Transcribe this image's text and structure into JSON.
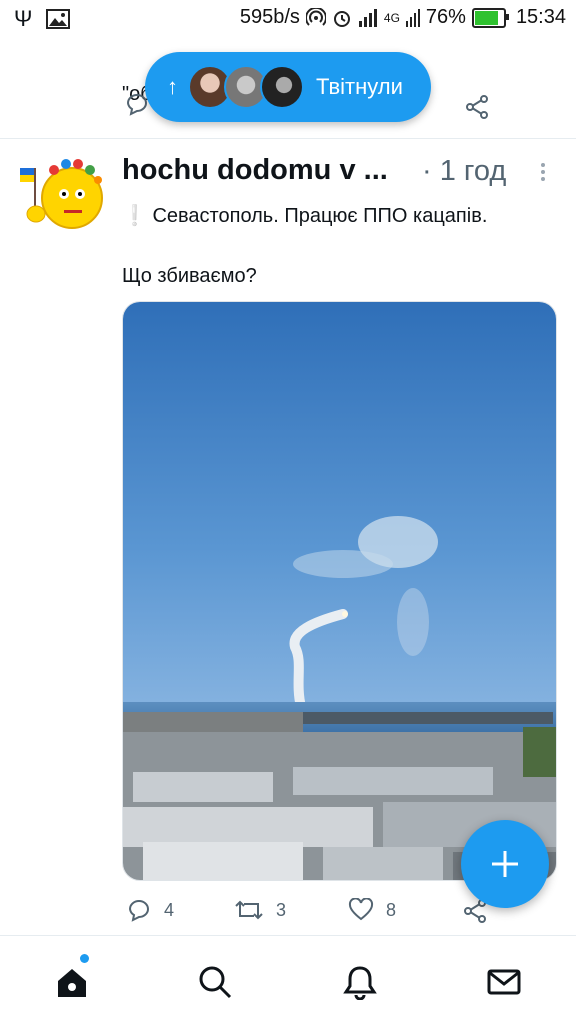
{
  "status_bar": {
    "net_speed": "595b/s",
    "network": "4G",
    "battery": "76%",
    "battery_fraction": 0.76,
    "time": "15:34"
  },
  "prev_tweet": {
    "text_fragment": "\"обо...\" ...хуїв."
  },
  "new_tweets_pill": {
    "label": "Твітнули"
  },
  "tweet": {
    "author_name": "hochu dodomu v ...",
    "time": "· 1 год",
    "line1_prefix": "❕",
    "line1": "Севастополь. Працює ППО кацапів.",
    "line2": "Що збиваємо?",
    "replies": "4",
    "retweets": "3",
    "likes": "8"
  },
  "colors": {
    "accent": "#1d9bf0",
    "text": "#0f1419",
    "secondary": "#536471"
  },
  "nav": [
    "home-icon",
    "search-icon",
    "notifications-icon",
    "messages-icon"
  ]
}
